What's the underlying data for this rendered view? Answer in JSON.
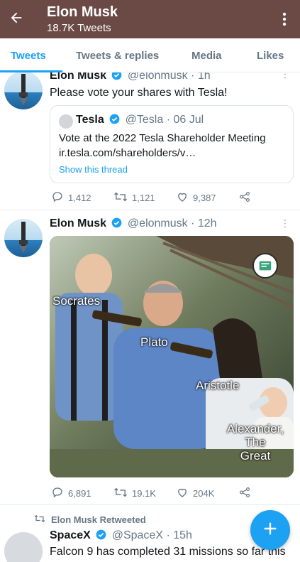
{
  "header": {
    "title": "Elon Musk",
    "subtitle": "18.7K Tweets"
  },
  "tabs": [
    {
      "label": "Tweets",
      "active": true
    },
    {
      "label": "Tweets & replies",
      "active": false
    },
    {
      "label": "Media",
      "active": false
    },
    {
      "label": "Likes",
      "active": false
    }
  ],
  "tweets": [
    {
      "author": "Elon Musk",
      "handle": "@elonmusk",
      "time": "· 1h",
      "text": "Please vote your shares with Tesla!",
      "quote": {
        "author": "Tesla",
        "handle": "@Tesla",
        "time": "· 06 Jul",
        "text": "Vote at the 2022 Tesla Shareholder Meeting",
        "link": "ir.tesla.com/shareholders/v…",
        "thread_link": "Show this thread"
      },
      "replies": "1,412",
      "retweets": "1,121",
      "likes": "9,387"
    },
    {
      "author": "Elon Musk",
      "handle": "@elonmusk",
      "time": "· 12h",
      "meme_labels": {
        "a": "Socrates",
        "b": "Plato",
        "c": "Aristotle",
        "d": "Alexander,\nThe\nGreat"
      },
      "replies": "6,891",
      "retweets": "19.1K",
      "likes": "204K"
    },
    {
      "retweet_context": "Elon Musk Retweeted",
      "author": "SpaceX",
      "handle": "@SpaceX",
      "time": "· 15h",
      "text": "Falcon 9 has completed 31 missions so far this"
    }
  ],
  "colors": {
    "header_bg": "#6b4a46",
    "accent": "#1da1f2",
    "muted": "#657786"
  },
  "icons": {
    "back": "arrow-left",
    "overflow": "vertical-dots",
    "reply": "speech-bubble",
    "retweet": "retweet-arrows",
    "like": "heart",
    "share": "share-nodes",
    "verified": "blue-check-badge",
    "compose": "plus"
  }
}
